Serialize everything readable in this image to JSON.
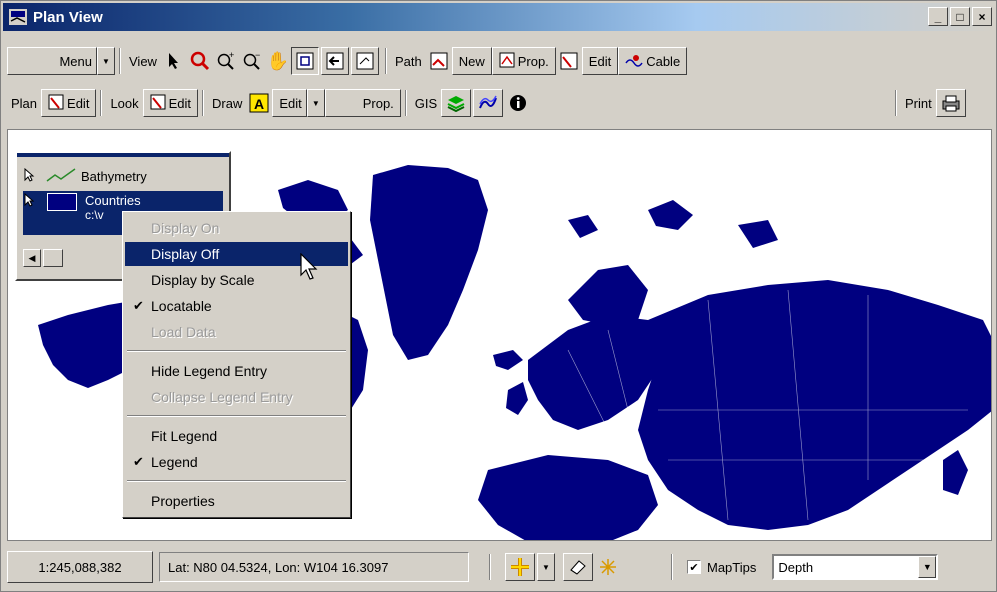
{
  "window": {
    "title": "Plan View",
    "controls": [
      "_",
      "□",
      "×"
    ]
  },
  "toolbar1": {
    "menu_label": "Menu",
    "view_label": "View",
    "path_label": "Path",
    "new_label": "New",
    "prop_label": "Prop.",
    "edit_label": "Edit",
    "cable_label": "Cable"
  },
  "toolbar2": {
    "plan_label": "Plan",
    "plan_edit_label": "Edit",
    "look_label": "Look",
    "look_edit_label": "Edit",
    "draw_label": "Draw",
    "draw_edit_label": "Edit",
    "draw_prop_label": "Prop.",
    "gis_label": "GIS",
    "print_label": "Print"
  },
  "legend": {
    "items": [
      {
        "label": "Bathymetry"
      },
      {
        "label": "Countries",
        "sub": "c:\\v"
      }
    ]
  },
  "context_menu": {
    "items": [
      {
        "label": "Display On",
        "disabled": true
      },
      {
        "label": "Display Off",
        "highlighted": true
      },
      {
        "label": "Display by Scale"
      },
      {
        "label": "Locatable",
        "checked": true
      },
      {
        "label": "Load Data",
        "disabled": true
      },
      {
        "label": "Hide Legend Entry"
      },
      {
        "label": "Collapse Legend Entry",
        "disabled": true
      },
      {
        "label": "Fit Legend"
      },
      {
        "label": "Legend",
        "checked": true
      },
      {
        "label": "Properties"
      }
    ]
  },
  "status": {
    "scale": "1:245,088,382",
    "coords": "Lat: N80 04.5324, Lon: W104 16.3097",
    "maptips_label": "MapTips",
    "maptips_checked": true,
    "depth_value": "Depth"
  },
  "colors": {
    "land": "#000080",
    "selection": "#0a246a",
    "chrome": "#d4d0c8"
  }
}
